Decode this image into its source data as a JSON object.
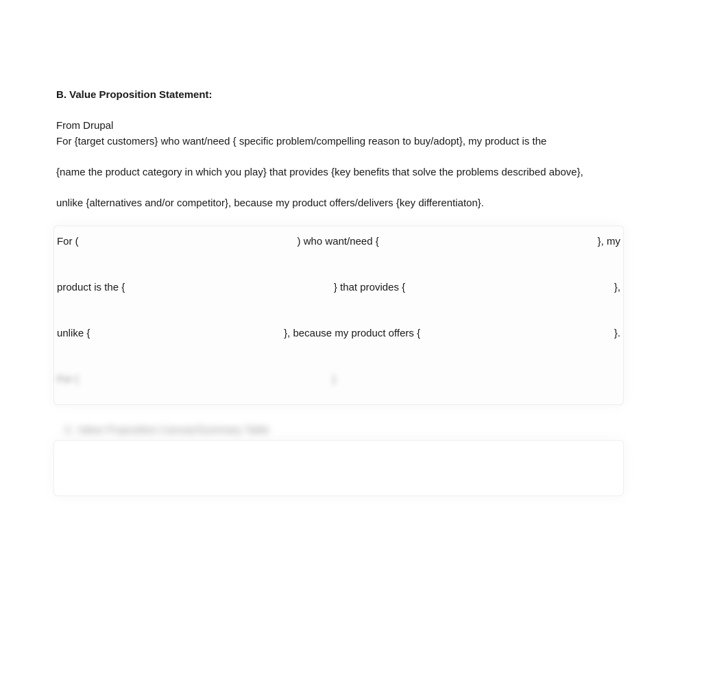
{
  "heading": "B. Value Proposition Statement:",
  "subheading": "From Drupal",
  "template": {
    "line1": "For  {target customers} who want/need { specific problem/compelling reason to buy/adopt}, my product is the",
    "line2": "{name the product category in which you play} that provides {key benefits that solve the problems described above},",
    "line3": "unlike  {alternatives and/or competitor}, because my product offers/delivers {key differentiaton}."
  },
  "fill": {
    "row1": {
      "a": "For (",
      "b": ") who want/need {",
      "c": "}, my"
    },
    "row2": {
      "a": "product is the {",
      "b": "} that provides {",
      "c": "},"
    },
    "row3": {
      "a": "unlike {",
      "b": "}, because my product offers {",
      "c": "}."
    },
    "blur": {
      "a": "For (",
      "b": "}"
    }
  },
  "sectionLabel": "C. Value Proposition Canvas/Summary Table"
}
